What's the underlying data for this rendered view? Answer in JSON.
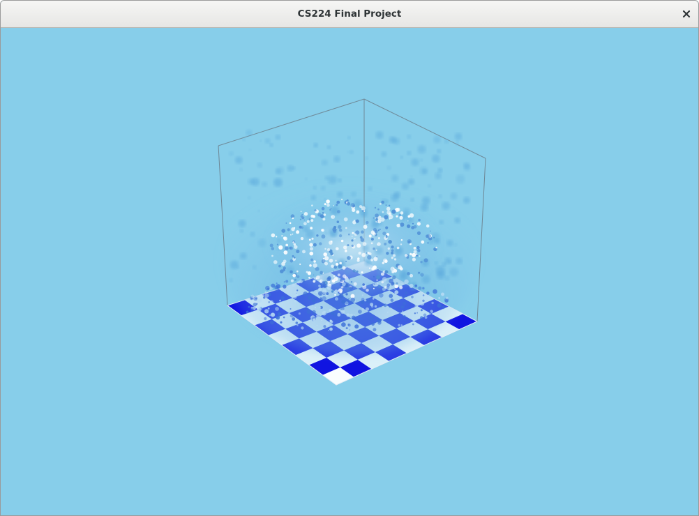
{
  "window": {
    "title": "CS224 Final Project",
    "close_icon": "close-icon"
  },
  "scene": {
    "background_color": "#87ceea",
    "floor_colors": [
      "#0a0ae0",
      "#ffffff"
    ],
    "water_color": "#5aa8dc",
    "foam_color": "#ffffff",
    "box_edge_color": "#6a7a86"
  }
}
